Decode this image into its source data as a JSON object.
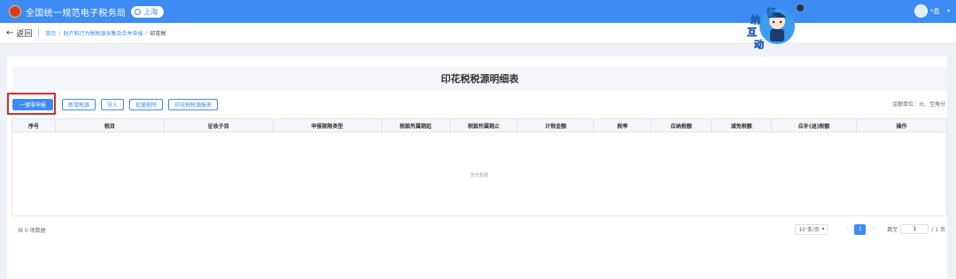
{
  "header": {
    "title": "全国统一规范电子税务局",
    "region": "上海",
    "user_name": "*昌"
  },
  "nav": {
    "back_label": "返回",
    "breadcrumbs": [
      "首页",
      "财产和行为税税源采集及合并申报",
      "印花税"
    ]
  },
  "mascot": {
    "chars": [
      "征",
      "纳",
      "互",
      "动"
    ]
  },
  "page": {
    "title": "印花税税源明细表",
    "unit_text": "金额单位：元、至角分"
  },
  "toolbar": {
    "buttons": [
      "一键零申报",
      "新增税源",
      "导入",
      "批量删除",
      "印花税税源报表"
    ]
  },
  "table": {
    "columns": [
      "序号",
      "税目",
      "征收子目",
      "申报期限类型",
      "税款所属期起",
      "税款所属期止",
      "计税金额",
      "税率",
      "应纳税额",
      "减免税额",
      "应补(退)税额",
      "操作"
    ],
    "empty_text": "暂无数据"
  },
  "pagination": {
    "total": "共 0 项数据",
    "page_size": "10 条/页",
    "current_page": "1",
    "goto_label": "跳至",
    "goto_value": "1",
    "total_pages": "/ 1 页"
  },
  "colors": {
    "primary": "#3e8bf4",
    "highlight": "#e02a2a"
  }
}
